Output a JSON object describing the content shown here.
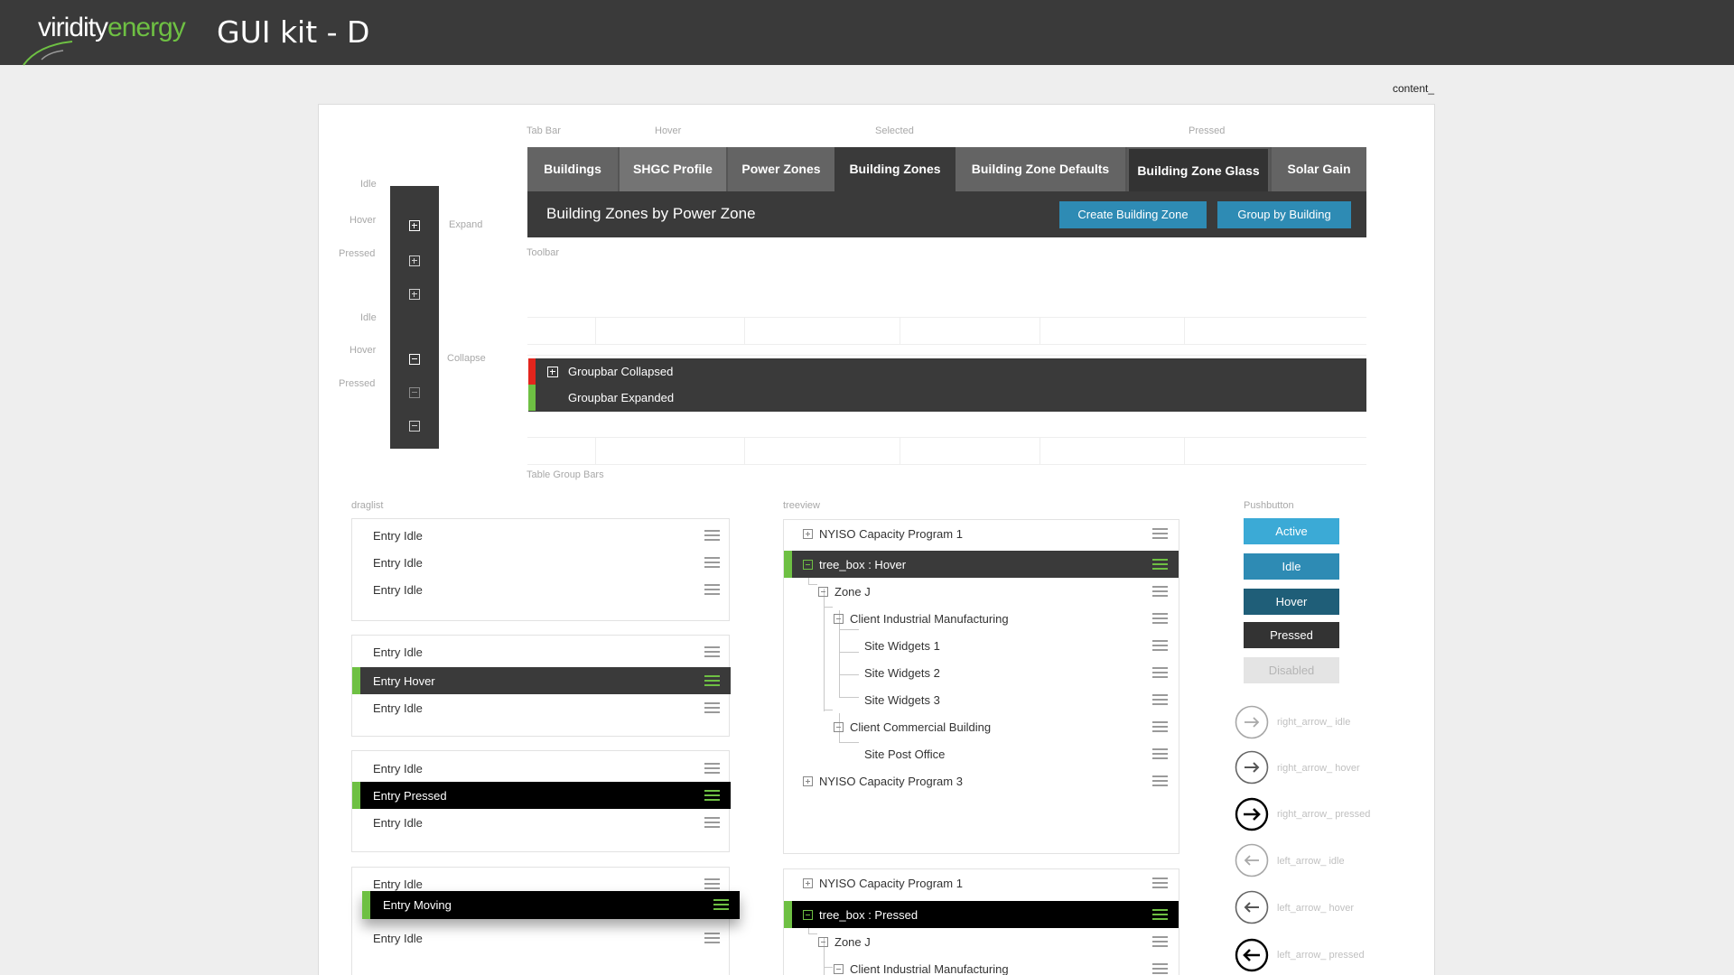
{
  "header": {
    "logo_part1": "viridity",
    "logo_part2": "energy",
    "title": "GUI kit - D"
  },
  "content_label": "content_",
  "expand_collapse": {
    "captions": {
      "idle": "Idle",
      "hover": "Hover",
      "pressed": "Pressed",
      "expand": "Expand",
      "collapse": "Collapse"
    }
  },
  "tabbar": {
    "captions": {
      "tab_bar": "Tab Bar",
      "hover": "Hover",
      "selected": "Selected",
      "pressed": "Pressed",
      "toolbar": "Toolbar"
    },
    "tabs": [
      {
        "label": "Buildings",
        "state": "idle"
      },
      {
        "label": "SHGC Profile",
        "state": "hover"
      },
      {
        "label": "Power Zones",
        "state": "idle"
      },
      {
        "label": "Building Zones",
        "state": "selected"
      },
      {
        "label": "Building Zone Defaults",
        "state": "idle"
      },
      {
        "label": "Building Zone Glass",
        "state": "pressed"
      },
      {
        "label": "Solar Gain",
        "state": "idle"
      }
    ]
  },
  "toolbar": {
    "title": "Building Zones by Power Zone",
    "create_label": "Create Building Zone",
    "group_label": "Group by Building"
  },
  "table_group": {
    "caption": "Table Group Bars",
    "collapsed_label": "Groupbar Collapsed",
    "expanded_label": "Groupbar Expanded",
    "colors": {
      "collapsed": "#e3251d",
      "expanded": "#6ec043"
    }
  },
  "draglist": {
    "caption": "draglist",
    "groups": [
      [
        "Entry Idle",
        "Entry Idle",
        "Entry Idle"
      ],
      [
        "Entry Idle",
        "Entry Hover",
        "Entry Idle"
      ],
      [
        "Entry Idle",
        "Entry Pressed",
        "Entry Idle"
      ],
      [
        "Entry Idle",
        "Entry Moving",
        "Entry Idle"
      ]
    ]
  },
  "treeview": {
    "caption": "treeview",
    "tree1": [
      "NYISO Capacity Program 1",
      "tree_box : Hover",
      "Zone J",
      "Client Industrial Manufacturing",
      "Site Widgets 1",
      "Site Widgets 2",
      "Site Widgets 3",
      "Client Commercial Building",
      "Site Post Office",
      "NYISO Capacity Program 3"
    ],
    "tree2": [
      "NYISO Capacity Program 1",
      "tree_box : Pressed",
      "Zone J",
      "Client Industrial Manufacturing"
    ]
  },
  "pushbutton": {
    "caption": "Pushbutton",
    "buttons": [
      {
        "label": "Active",
        "color": "#3baad6"
      },
      {
        "label": "Idle",
        "color": "#2e8bb4"
      },
      {
        "label": "Hover",
        "color": "#1f5e78"
      },
      {
        "label": "Pressed",
        "color": "#333333"
      },
      {
        "label": "Disabled",
        "color": "#e4e4e4"
      }
    ],
    "arrows": [
      {
        "label": "right_arrow_ idle",
        "icon": "right-arrow-icon"
      },
      {
        "label": "right_arrow_ hover",
        "icon": "right-arrow-icon"
      },
      {
        "label": "right_arrow_ pressed",
        "icon": "right-arrow-icon"
      },
      {
        "label": "left_arrow_ idle",
        "icon": "left-arrow-icon"
      },
      {
        "label": "left_arrow_ hover",
        "icon": "left-arrow-icon"
      },
      {
        "label": "left_arrow_ pressed",
        "icon": "left-arrow-icon"
      }
    ]
  },
  "accent_color": "#6ec043"
}
